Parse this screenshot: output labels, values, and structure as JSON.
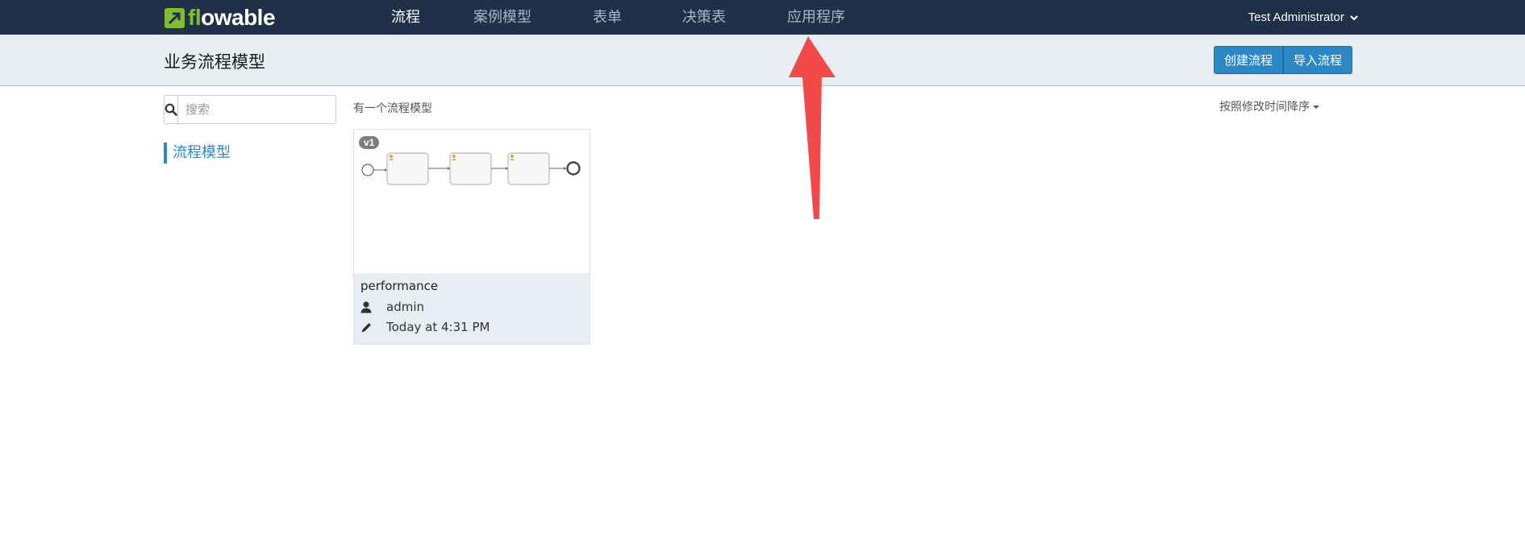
{
  "brand": {
    "logo_prefix": "fl",
    "logo_suffix": "owable",
    "accent": "#7fbd32"
  },
  "nav": {
    "items": [
      {
        "label": "流程",
        "active": true
      },
      {
        "label": "案例模型",
        "active": false
      },
      {
        "label": "表单",
        "active": false
      },
      {
        "label": "决策表",
        "active": false
      },
      {
        "label": "应用程序",
        "active": false
      }
    ],
    "user": "Test Administrator",
    "user_icon": "chevron-down-icon"
  },
  "header": {
    "title": "业务流程模型",
    "create_label": "创建流程",
    "import_label": "导入流程"
  },
  "sidebar": {
    "search_placeholder": "搜索",
    "search_icon": "search-icon",
    "items": [
      {
        "label": "流程模型",
        "active": true
      }
    ]
  },
  "main": {
    "count_text": "有一个流程模型",
    "sort_label": "按照修改时间降序",
    "models": [
      {
        "version": "v1",
        "name": "performance",
        "author": "admin",
        "modified": "Today at 4:31 PM",
        "author_icon": "user-icon",
        "modified_icon": "pencil-icon"
      }
    ]
  },
  "colors": {
    "navbar": "#1f3048",
    "primary": "#2d87c4",
    "subheader": "#e8edf2",
    "annotation_arrow": "#f24a4a"
  }
}
